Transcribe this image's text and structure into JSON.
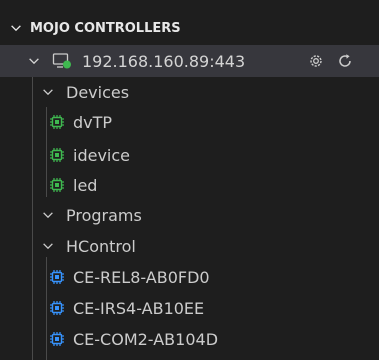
{
  "section": {
    "title": "MOJO CONTROLLERS"
  },
  "host": {
    "address": "192.168.160.89:443",
    "status_color": "#3fb950",
    "icons": [
      "monitor-icon",
      "settings-icon",
      "refresh-icon"
    ]
  },
  "devices": {
    "label": "Devices",
    "items": [
      {
        "label": "dvTP",
        "icon": "chip-icon",
        "color": "#3fb950"
      },
      {
        "label": "idevice",
        "icon": "chip-icon",
        "color": "#3fb950"
      },
      {
        "label": "led",
        "icon": "chip-icon",
        "color": "#3fb950"
      }
    ]
  },
  "programs": {
    "label": "Programs"
  },
  "hcontrol": {
    "label": "HControl",
    "items": [
      {
        "label": "CE-REL8-AB0FD0",
        "icon": "chip-icon",
        "color": "#3794ff"
      },
      {
        "label": "CE-IRS4-AB10EE",
        "icon": "chip-icon",
        "color": "#3794ff"
      },
      {
        "label": "CE-COM2-AB104D",
        "icon": "chip-icon",
        "color": "#3794ff"
      }
    ]
  }
}
